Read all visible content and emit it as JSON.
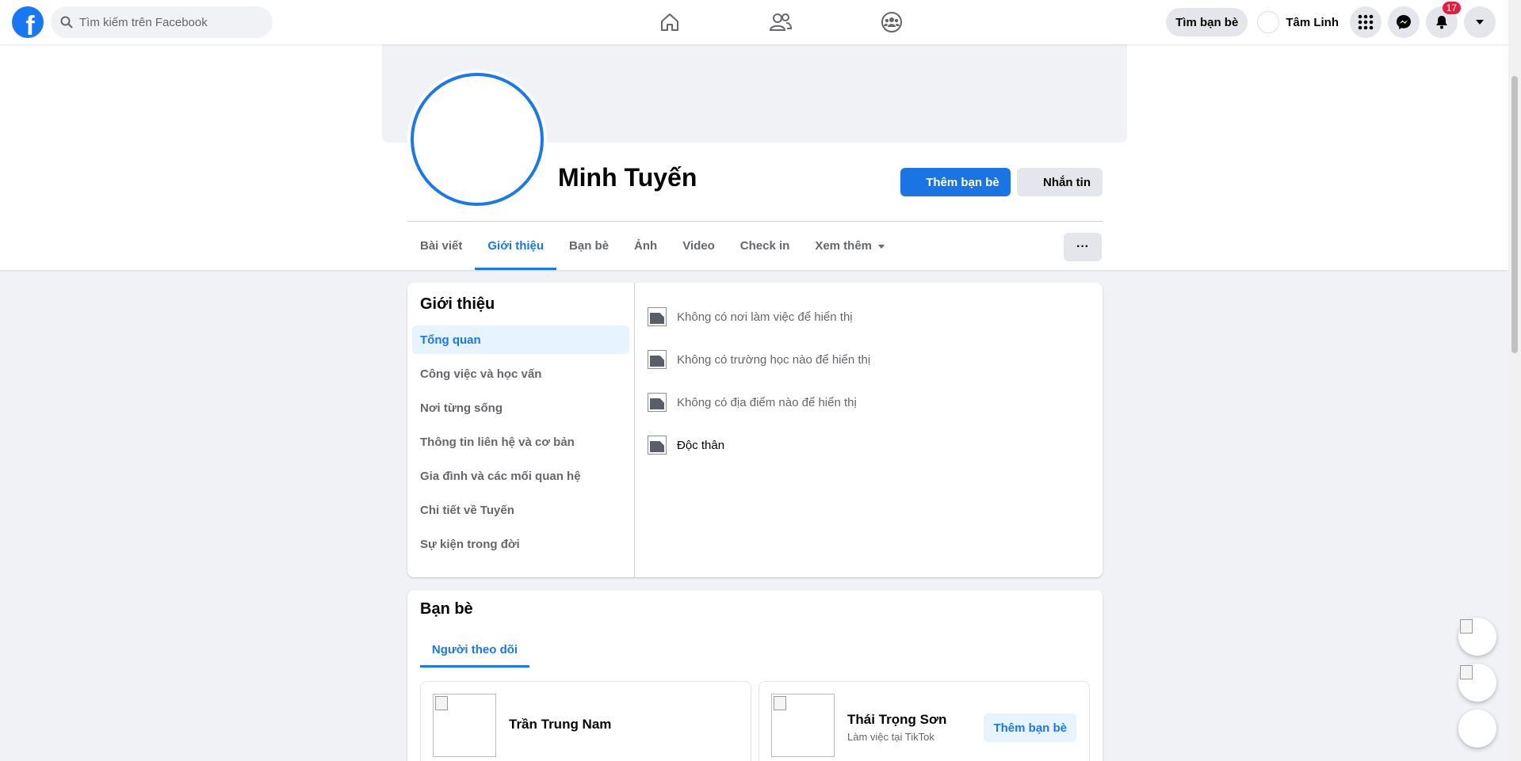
{
  "topbar": {
    "search_placeholder": "Tìm kiếm trên Facebook",
    "find_friends": "Tìm bạn bè",
    "user_name": "Tâm Linh",
    "notification_count": "17",
    "logo_letter": "f",
    "nav_icons": [
      "home-icon",
      "friends-icon",
      "groups-icon"
    ]
  },
  "profile": {
    "name": "Minh Tuyến",
    "add_friend": "Thêm bạn bè",
    "message": "Nhắn tin",
    "more": "···"
  },
  "tabs": [
    "Bài viết",
    "Giới thiệu",
    "Bạn bè",
    "Ảnh",
    "Video",
    "Check in",
    "Xem thêm"
  ],
  "about": {
    "title": "Giới thiệu",
    "menu": [
      "Tổng quan",
      "Công việc và học vấn",
      "Nơi từng sống",
      "Thông tin liên hệ và cơ bản",
      "Gia đình và các mối quan hệ",
      "Chi tiết về Tuyến",
      "Sự kiện trong đời"
    ],
    "items": [
      "Không có nơi làm việc để hiển thị",
      "Không có trường học nào để hiển thị",
      "Không có địa điểm nào để hiển thị",
      "Độc thân"
    ]
  },
  "friends": {
    "title": "Bạn bè",
    "tab": "Người theo dõi",
    "list": [
      {
        "name": "Trần Trung Nam",
        "sub": ""
      },
      {
        "name": "Thái Trọng Sơn",
        "sub": "Làm việc tại TikTok",
        "action": "Thêm bạn bè"
      }
    ]
  },
  "colors": {
    "brand": "#1877f2",
    "badge": "#e41e3f"
  }
}
